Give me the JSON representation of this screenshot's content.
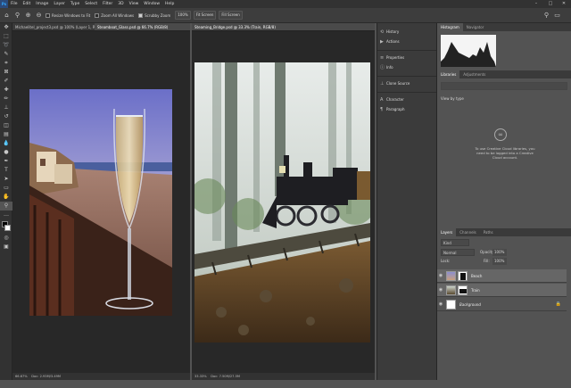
{
  "app": {
    "logo": "Ps"
  },
  "menu": [
    "File",
    "Edit",
    "Image",
    "Layer",
    "Type",
    "Select",
    "Filter",
    "3D",
    "View",
    "Window",
    "Help"
  ],
  "window_controls": {
    "minimize": "–",
    "maximize": "□",
    "close": "✕"
  },
  "options": {
    "resize_windows_label": "Resize Windows to Fit",
    "zoom_all_label": "Zoom All Windows",
    "scrubby_zoom_label": "Scrubby Zoom",
    "zoom_percent": "100%",
    "fit_screen": "Fit Screen",
    "fill_screen": "Fill Screen"
  },
  "docs": [
    {
      "tab": "Michaelitel_project3.psd @ 100% (Layer 1, RGB/8#)",
      "zoom": "66.67%",
      "status": "Doc: 2.93M/3.49M"
    },
    {
      "tab": "Steamboat_Glass.psd @ 66.7% (RGB/8)",
      "zoom": "",
      "status": ""
    },
    {
      "tab": "Steaming_Bridge.psd @ 33.3% (Train, RGB/8)",
      "zoom": "33.33%",
      "status": "Doc: 7.50M/27.5M"
    }
  ],
  "panel_column": {
    "group1": [
      "History",
      "Actions"
    ],
    "group2": [
      "Properties",
      "Info"
    ],
    "group3": [
      "Clone Source"
    ],
    "group4": [
      "Character",
      "Paragraph"
    ]
  },
  "histogram": {
    "tabs": [
      "Histogram",
      "Navigator"
    ]
  },
  "libraries": {
    "tabs": [
      "Libraries",
      "Adjustments"
    ],
    "view_by": "View by type",
    "message": "To use Creative Cloud libraries, you need to be logged into a Creative Cloud account."
  },
  "layers_panel": {
    "tabs": [
      "Layers",
      "Channels",
      "Paths"
    ],
    "filter_kind": "Kind",
    "blend_mode": "Normal",
    "opacity_label": "Opacity:",
    "opacity_value": "100%",
    "lock_label": "Lock:",
    "fill_label": "Fill:",
    "fill_value": "100%",
    "layers": [
      {
        "name": "Beach",
        "selected": true
      },
      {
        "name": "Train",
        "selected": true
      },
      {
        "name": "Background",
        "selected": false
      }
    ]
  }
}
